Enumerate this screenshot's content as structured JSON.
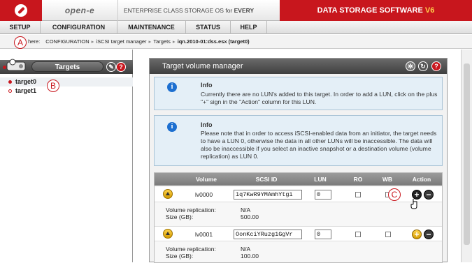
{
  "header": {
    "brand": "open-e",
    "tagline_prefix": "ENTERPRISE CLASS STORAGE OS for ",
    "tagline_bold": "EVERY BUSINESS",
    "product": "DATA STORAGE SOFTWARE ",
    "product_version": "V6"
  },
  "nav": {
    "items": [
      "SETUP",
      "CONFIGURATION",
      "MAINTENANCE",
      "STATUS",
      "HELP"
    ]
  },
  "breadcrumb": {
    "label": "here:",
    "path": [
      "CONFIGURATION",
      "iSCSI target manager",
      "Targets"
    ],
    "current": "iqn.2010-01:dss.esx (target0)"
  },
  "left_panel": {
    "title": "Targets",
    "tree": [
      "target0",
      "target1"
    ]
  },
  "callouts": [
    "A",
    "B",
    "C"
  ],
  "main_panel": {
    "title": "Target volume manager",
    "info_boxes": [
      {
        "title": "Info",
        "text": "Currently there are no LUN's added to this target. In order to add a LUN, click on the plus \"+\" sign in the \"Action\" column for this LUN."
      },
      {
        "title": "Info",
        "text": "Please note that in order to access iSCSI-enabled data from an initiator, the target needs to have a LUN 0, otherwise the data in all other LUNs will be inaccessible. The data will also be inaccessible if you select an inactive snapshot or a destination volume (volume replication) as LUN 0."
      }
    ],
    "table": {
      "columns": [
        "Volume",
        "SCSI ID",
        "LUN",
        "RO",
        "WB",
        "Action"
      ],
      "rows": [
        {
          "volume": "lv0000",
          "scsi_id": "1q7KwR9YMAmhYtgi",
          "lun": "0",
          "replication_label": "Volume replication:",
          "replication": "N/A",
          "size_label": "Size (GB):",
          "size": "500.00"
        },
        {
          "volume": "lv0001",
          "scsi_id": "OonKciYRuzg1GgVr",
          "lun": "0",
          "replication_label": "Volume replication:",
          "replication": "N/A",
          "size_label": "Size (GB):",
          "size": "100.00"
        }
      ]
    }
  }
}
